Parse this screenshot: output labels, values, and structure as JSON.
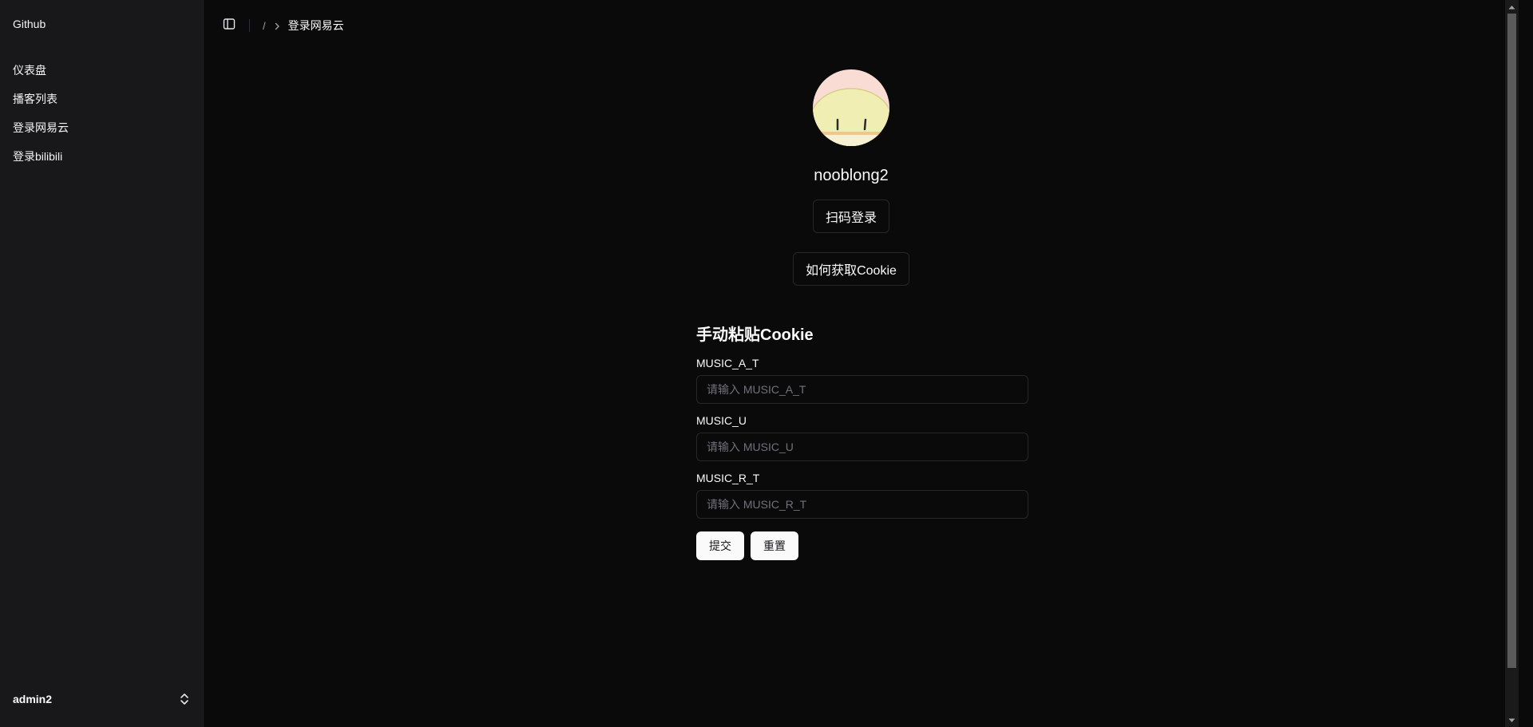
{
  "sidebar": {
    "brand": "Github",
    "items": [
      {
        "label": "仪表盘"
      },
      {
        "label": "播客列表"
      },
      {
        "label": "登录网易云"
      },
      {
        "label": "登录bilibili"
      }
    ],
    "user": {
      "name": "admin2"
    }
  },
  "breadcrumb": {
    "separator": "/",
    "current": "登录网易云"
  },
  "profile": {
    "username": "nooblong2",
    "qr_login_label": "扫码登录",
    "how_cookie_label": "如何获取Cookie"
  },
  "form": {
    "title": "手动粘贴Cookie",
    "fields": [
      {
        "label": "MUSIC_A_T",
        "placeholder": "请输入 MUSIC_A_T"
      },
      {
        "label": "MUSIC_U",
        "placeholder": "请输入 MUSIC_U"
      },
      {
        "label": "MUSIC_R_T",
        "placeholder": "请输入 MUSIC_R_T"
      }
    ],
    "submit_label": "提交",
    "reset_label": "重置"
  },
  "colors": {
    "background": "#0a0a0b",
    "sidebar": "#18181b",
    "border": "#27272a",
    "text": "#fafafa"
  }
}
